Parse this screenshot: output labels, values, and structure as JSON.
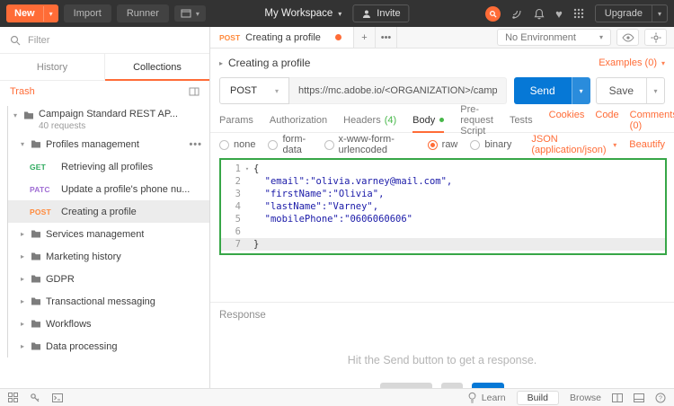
{
  "colors": {
    "accent": "#ff6c37",
    "send_blue": "#0678d6",
    "success_green": "#47b749",
    "editor_border_green": "#37a647"
  },
  "topbar": {
    "new_label": "New",
    "import_label": "Import",
    "runner_label": "Runner",
    "workspace_label": "My Workspace",
    "invite_label": "Invite",
    "upgrade_label": "Upgrade"
  },
  "sidebar": {
    "filter_placeholder": "Filter",
    "tab_history": "History",
    "tab_collections": "Collections",
    "trash_label": "Trash",
    "collection_name": "Campaign Standard REST AP...",
    "collection_meta": "40 requests",
    "items": [
      {
        "method": "",
        "label": "Profiles management"
      },
      {
        "method": "GET",
        "label": "Retrieving all profiles"
      },
      {
        "method": "PATC",
        "label": "Update a profile's phone nu..."
      },
      {
        "method": "POST",
        "label": "Creating a profile"
      },
      {
        "method": "",
        "label": "Services management"
      },
      {
        "method": "",
        "label": "Marketing history"
      },
      {
        "method": "",
        "label": "GDPR"
      },
      {
        "method": "",
        "label": "Transactional messaging"
      },
      {
        "method": "",
        "label": "Workflows"
      },
      {
        "method": "",
        "label": "Data processing"
      }
    ]
  },
  "tabstrip": {
    "tab_method": "POST",
    "tab_title": "Creating a profile",
    "environment": "No Environment"
  },
  "request": {
    "title": "Creating a profile",
    "examples_label": "Examples (0)",
    "method": "POST",
    "url": "https://mc.adobe.io/<ORGANIZATION>/campaign/profileAndServices/profile/",
    "send_label": "Send",
    "save_label": "Save",
    "tabs": [
      {
        "label": "Params",
        "count": ""
      },
      {
        "label": "Authorization",
        "count": ""
      },
      {
        "label": "Headers",
        "count": "(4)"
      },
      {
        "label": "Body",
        "count": ""
      },
      {
        "label": "Pre-request Script",
        "count": ""
      },
      {
        "label": "Tests",
        "count": ""
      }
    ],
    "cookies_label": "Cookies",
    "code_label": "Code",
    "comments_label": "Comments (0)",
    "body_modes": [
      "none",
      "form-data",
      "x-www-form-urlencoded",
      "raw",
      "binary"
    ],
    "selected_body_mode": "raw",
    "content_type": "JSON (application/json)",
    "beautify_label": "Beautify"
  },
  "editor": {
    "lines": [
      {
        "n": "1",
        "text": "{"
      },
      {
        "n": "2",
        "text": "  \"email\":\"olivia.varney@mail.com\","
      },
      {
        "n": "3",
        "text": "  \"firstName\":\"Olivia\","
      },
      {
        "n": "4",
        "text": "  \"lastName\":\"Varney\","
      },
      {
        "n": "5",
        "text": "  \"mobilePhone\":\"0606060606\""
      },
      {
        "n": "6",
        "text": ""
      },
      {
        "n": "7",
        "text": "}"
      }
    ]
  },
  "response": {
    "title": "Response",
    "empty_message": "Hit the Send button to get a response."
  },
  "statusbar": {
    "learn_label": "Learn",
    "build_label": "Build",
    "browse_label": "Browse"
  }
}
